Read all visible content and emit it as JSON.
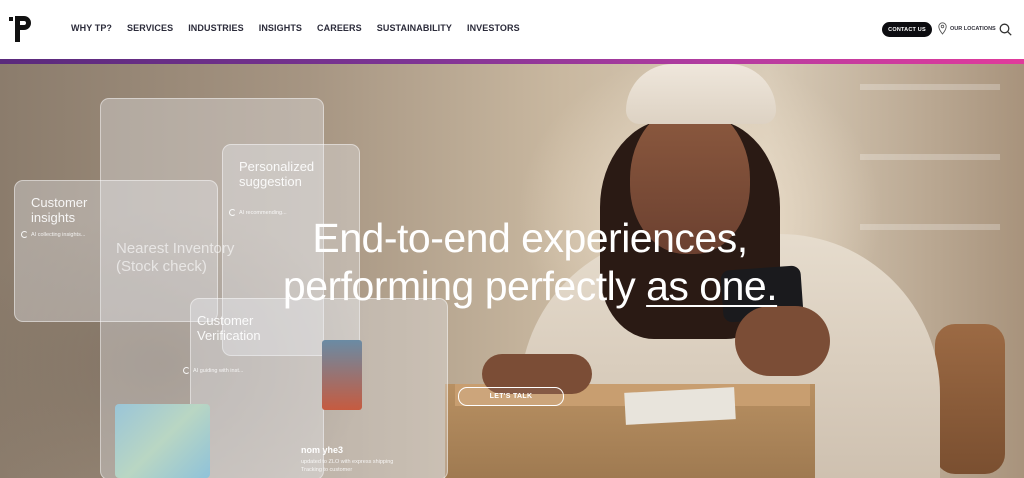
{
  "nav": {
    "logo_alt": "TP",
    "items": [
      "WHY TP?",
      "SERVICES",
      "INDUSTRIES",
      "INSIGHTS",
      "CAREERS",
      "SUSTAINABILITY",
      "INVESTORS"
    ],
    "contact_label": "CONTACT US",
    "locations_label": "OUR LOCATIONS"
  },
  "colors": {
    "gradient_start": "#5a2a7c",
    "gradient_end": "#e13a9c",
    "contact_bg": "#0c0c10"
  },
  "hero": {
    "headline_line1": "End-to-end experiences,",
    "headline_line2_prefix": "performing perfectly ",
    "headline_line2_underlined": "as one.",
    "cta_label": "LET'S TALK",
    "panels": {
      "customer_insights": {
        "title_line1": "Customer",
        "title_line2": "insights",
        "status": "AI collecting insights..."
      },
      "personalized": {
        "title_line1": "Personalized",
        "title_line2": "suggestion",
        "status": "AI recommending..."
      },
      "inventory": {
        "title_line1": "Nearest Inventory",
        "title_line2": "(Stock check)"
      },
      "verification": {
        "title_line1": "Customer",
        "title_line2": "Verification",
        "status": "AI guiding with inst..."
      },
      "shipping": {
        "line1": "nom yhe3",
        "line2": "updated to ZLO with express shipping",
        "line3": "Tracking to customer"
      }
    }
  }
}
